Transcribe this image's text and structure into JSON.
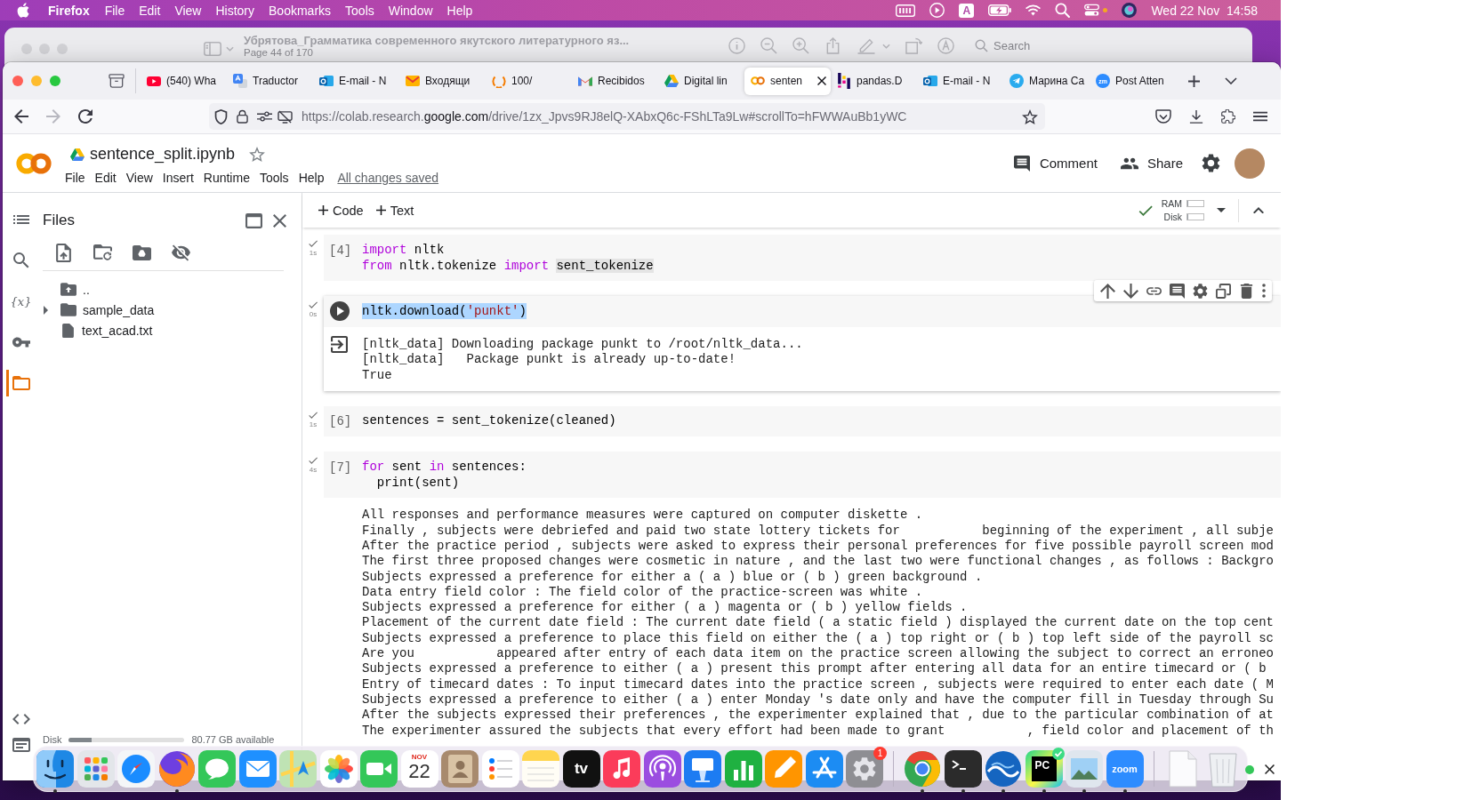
{
  "menu_bar": {
    "app_name": "Firefox",
    "items": [
      "File",
      "Edit",
      "View",
      "History",
      "Bookmarks",
      "Tools",
      "Window",
      "Help"
    ],
    "input_source": "A",
    "clock": "Wed 22 Nov  14:58"
  },
  "background_window": {
    "title": "Убрятова_Грамматика современного якутского литературного яз...",
    "subtitle": "Page 44 of 170",
    "search": {
      "placeholder": "Search"
    }
  },
  "browser": {
    "tabs": [
      {
        "title": "(540) Wha",
        "kind": "play",
        "selected": false
      },
      {
        "title": "Traductor",
        "kind": "translate",
        "selected": false
      },
      {
        "title": "E-mail - N",
        "kind": "mailbox",
        "selected": false
      },
      {
        "title": "Входящи",
        "kind": "envelope",
        "selected": false
      },
      {
        "title": "100/",
        "kind": "ring",
        "selected": false
      },
      {
        "title": "Recibidos",
        "kind": "gmail",
        "selected": false
      },
      {
        "title": "Digital lin",
        "kind": "triangle",
        "selected": false
      },
      {
        "title": "senten",
        "kind": "rings",
        "selected": true
      },
      {
        "title": "pandas.D",
        "kind": "bars",
        "selected": false
      },
      {
        "title": "E-mail - N",
        "kind": "mailbox",
        "selected": false
      },
      {
        "title": "Марина Са",
        "kind": "plane",
        "selected": false
      },
      {
        "title": "Post Atten",
        "kind": "badge",
        "badge": "zm",
        "selected": false
      }
    ],
    "can_go_forward": false,
    "url": {
      "prefix": "https://colab.research.",
      "domain": "google.com",
      "suffix": "/drive/1zx_Jpvs9RJ8elQ-XAbxQ6c-FShLTa9Lw#scrollTo=hFWWAuBb1yWC"
    }
  },
  "notebook": {
    "title": "sentence_split.ipynb",
    "starred": false,
    "menu": [
      "File",
      "Edit",
      "View",
      "Insert",
      "Runtime",
      "Tools",
      "Help"
    ],
    "save_status": "All changes saved",
    "actions": [
      {
        "label": "Comment",
        "kind": "comment"
      },
      {
        "label": "Share",
        "kind": "share"
      }
    ],
    "toolbar": {
      "insert": [
        "Code",
        "Text"
      ],
      "connected": true,
      "resources": [
        {
          "label": "RAM",
          "level": 0
        },
        {
          "label": "Disk",
          "level": 0
        }
      ]
    },
    "sidebar": {
      "rail": [
        {
          "kind": "toc",
          "selected": false
        },
        {
          "kind": "search",
          "selected": false
        },
        {
          "kind": "variables",
          "glyph": "{x}",
          "selected": false
        },
        {
          "kind": "secrets",
          "selected": false
        },
        {
          "kind": "files",
          "selected": true
        }
      ],
      "rail_bottom": [
        {
          "kind": "snippets"
        },
        {
          "kind": "terminal"
        }
      ],
      "panel": {
        "title": "Files",
        "tree": [
          {
            "name": "..",
            "kind": "parent"
          },
          {
            "name": "sample_data",
            "kind": "folder",
            "expanded": false
          },
          {
            "name": "text_acad.txt",
            "kind": "file"
          }
        ],
        "disk": {
          "label": "Disk",
          "level": 0.2,
          "available": "80.77 GB available"
        }
      }
    },
    "cells": [
      {
        "count": "[4]",
        "focused": false,
        "finished": true,
        "time": "1s",
        "lines": [
          {
            "selected": false,
            "tokens": [
              {
                "text": "import",
                "kind": "keyword",
                "highlighted": false
              },
              {
                "text": " nltk",
                "kind": "name",
                "highlighted": false
              }
            ]
          },
          {
            "selected": false,
            "tokens": [
              {
                "text": "from",
                "kind": "keyword",
                "highlighted": false
              },
              {
                "text": " nltk.tokenize ",
                "kind": "name",
                "highlighted": false
              },
              {
                "text": "import ",
                "kind": "keyword",
                "highlighted": false
              },
              {
                "text": "sent_tokenize",
                "kind": "name",
                "highlighted": true
              }
            ]
          }
        ]
      },
      {
        "focused": true,
        "finished": true,
        "time": "0s",
        "lines": [
          {
            "selected": true,
            "tokens": [
              {
                "text": "nltk.download(",
                "kind": "name",
                "highlighted": false
              },
              {
                "text": "'punkt'",
                "kind": "string",
                "highlighted": false
              },
              {
                "text": ")",
                "kind": "name",
                "highlighted": false
              }
            ]
          }
        ],
        "output": [
          "[nltk_data] Downloading package punkt to /root/nltk_data...",
          "[nltk_data]   Package punkt is already up-to-date!",
          "True"
        ]
      },
      {
        "count": "[6]",
        "focused": false,
        "finished": true,
        "time": "1s",
        "lines": [
          {
            "selected": false,
            "tokens": [
              {
                "text": "sentences = sent_tokenize(cleaned)",
                "kind": "name",
                "highlighted": false
              }
            ]
          }
        ]
      },
      {
        "count": "[7]",
        "focused": false,
        "finished": true,
        "time": "4s",
        "lines": [
          {
            "selected": false,
            "tokens": [
              {
                "text": "for",
                "kind": "keyword",
                "highlighted": false
              },
              {
                "text": " sent ",
                "kind": "name",
                "highlighted": false
              },
              {
                "text": "in",
                "kind": "keyword",
                "highlighted": false
              },
              {
                "text": " sentences:",
                "kind": "name",
                "highlighted": false
              }
            ]
          },
          {
            "selected": false,
            "tokens": [
              {
                "text": "  print(sent)",
                "kind": "name",
                "highlighted": false
              }
            ]
          }
        ],
        "output": [
          "All responses and performance measures were captured on computer diskette .",
          "Finally , subjects were debriefed and paid two state lottery tickets for           beginning of the experiment , all subje",
          "After the practice period , subjects were asked to express their personal preferences for five possible payroll screen mod",
          "The first three proposed changes were cosmetic in nature , and the last two were functional changes , as follows : Backgro",
          "Subjects expressed a preference for either a ( a ) blue or ( b ) green background .",
          "Data entry field color : The field color of the practice-screen was white .",
          "Subjects expressed a preference for either ( a ) magenta or ( b ) yellow fields .",
          "Placement of the current date field : The current date field ( a static field ) displayed the current date on the top cent",
          "Subjects expressed a preference to place this field on either the ( a ) top right or ( b ) top left side of the payroll sc",
          "Are you           appeared after entry of each data item on the practice screen allowing the subject to correct an erroneo",
          "Subjects expressed a preference to either ( a ) present this prompt after entering all data for an entire timecard or ( b",
          "Entry of timecard dates : To input timecard dates into the practice screen , subjects were required to enter each date ( M",
          "Subjects expressed a preference to either ( a ) enter Monday 's date only and have the computer fill in Tuesday through Su",
          "After the subjects expressed their preferences , the experimenter explained that , due to the particular combination of at",
          "The experimenter assured the subjects that every effort had been made to grant           , field color and placement of th"
        ]
      }
    ]
  },
  "dock": {
    "sections": [
      {
        "items": [
          {
            "kind": "face",
            "running": true
          },
          {
            "kind": "grid",
            "running": false
          },
          {
            "kind": "compass",
            "running": false
          },
          {
            "kind": "fox",
            "running": true
          },
          {
            "kind": "chat",
            "running": false
          },
          {
            "kind": "envelope",
            "running": false
          },
          {
            "kind": "map",
            "running": false
          },
          {
            "kind": "flower",
            "running": false
          },
          {
            "kind": "camera",
            "running": false
          },
          {
            "kind": "calendar",
            "month": "NOV",
            "day": "22",
            "running": false
          },
          {
            "kind": "contacts",
            "running": false
          },
          {
            "kind": "checklist",
            "running": false
          },
          {
            "kind": "notes",
            "running": false
          },
          {
            "kind": "tv",
            "label": "tv",
            "running": false
          },
          {
            "kind": "music",
            "running": false
          },
          {
            "kind": "podcast",
            "running": false
          },
          {
            "kind": "podium",
            "running": false
          },
          {
            "kind": "chart",
            "running": false
          },
          {
            "kind": "pencil",
            "running": false
          },
          {
            "kind": "store",
            "running": false
          },
          {
            "kind": "gear",
            "badge": "1",
            "running": false
          }
        ]
      },
      {
        "items": [
          {
            "kind": "browser",
            "running": true
          },
          {
            "kind": "terminal",
            "running": true
          },
          {
            "kind": "wave",
            "running": true
          },
          {
            "kind": "ide",
            "label": "PC",
            "running": true
          },
          {
            "kind": "photo",
            "running": true
          },
          {
            "kind": "video",
            "label": "zoom",
            "running": true
          }
        ]
      },
      {
        "items": [
          {
            "kind": "document",
            "running": false
          },
          {
            "kind": "trash",
            "running": false
          }
        ]
      }
    ]
  }
}
